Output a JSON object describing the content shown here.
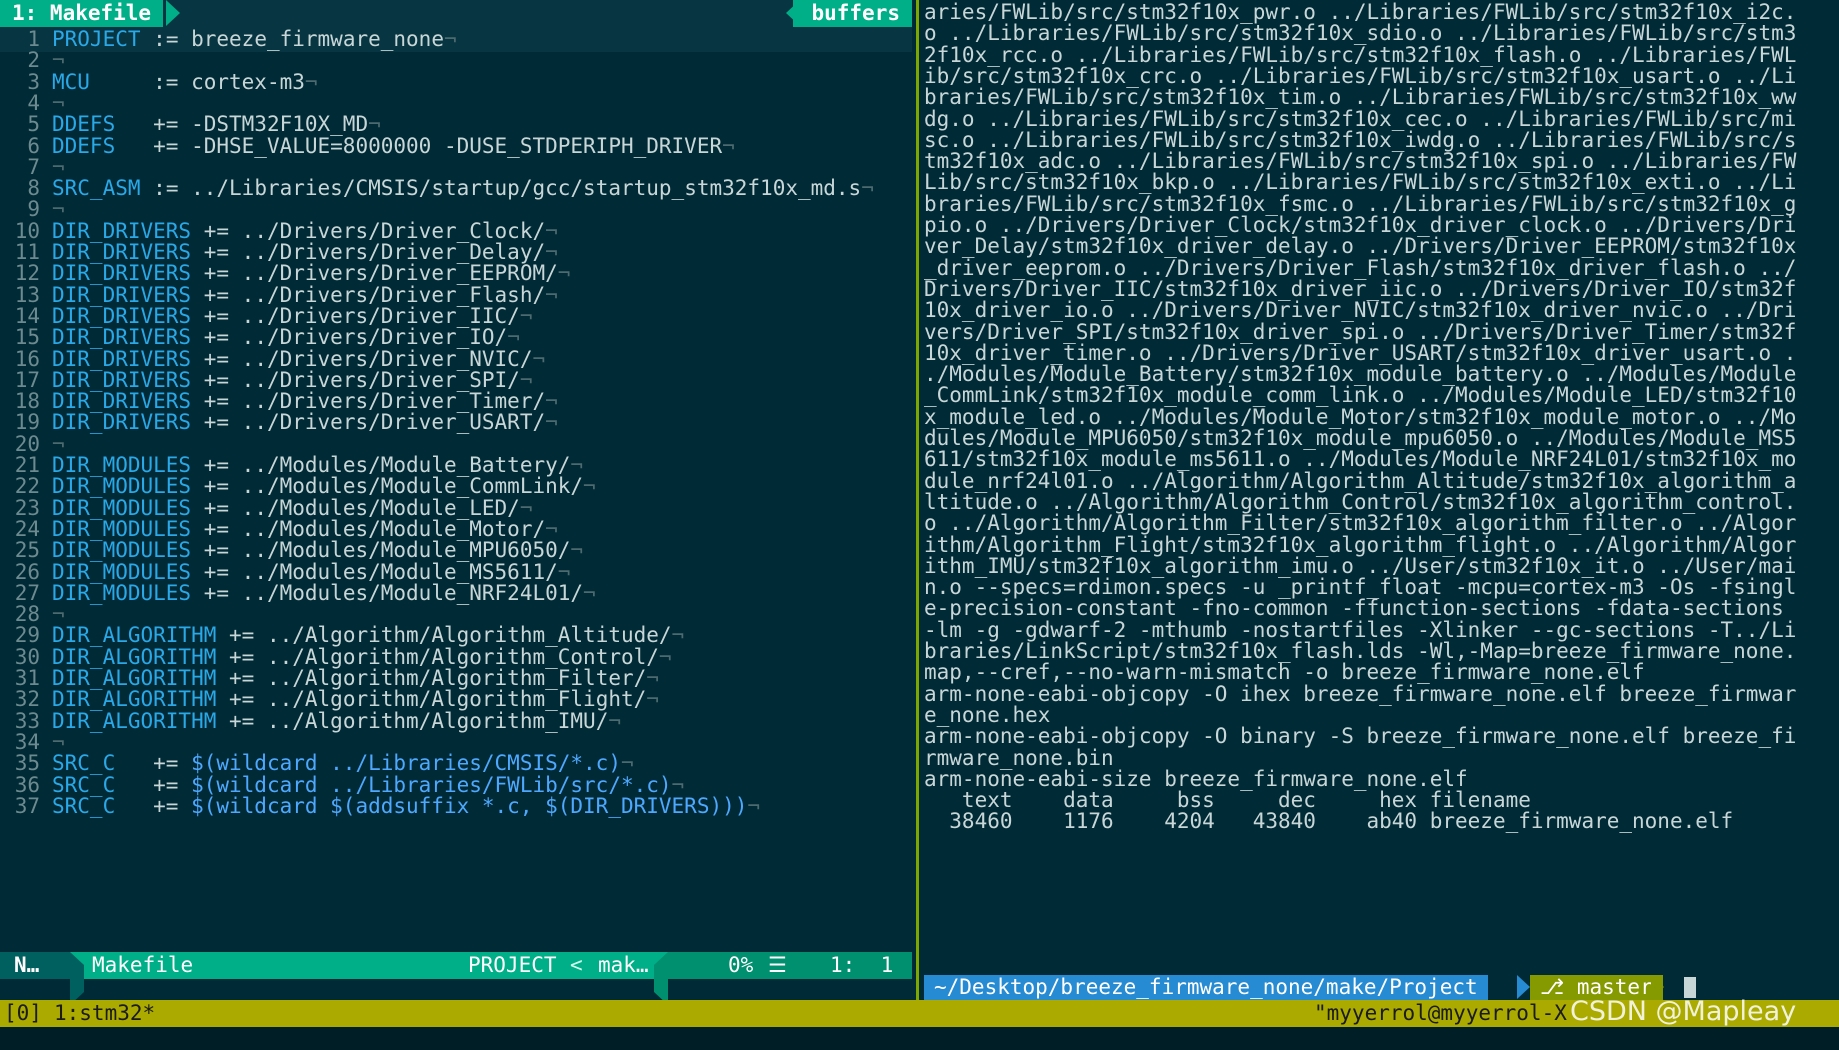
{
  "vim": {
    "tab_active": "1: Makefile",
    "tab_buffers": "buffers",
    "lines": [
      {
        "n": "1",
        "kw": "PROJECT",
        "pad": " ",
        "op": ":= ",
        "rest": "breeze_firmware_none"
      },
      {
        "n": "2",
        "kw": "",
        "pad": "",
        "op": "",
        "rest": ""
      },
      {
        "n": "3",
        "kw": "MCU",
        "pad": "     ",
        "op": ":= ",
        "rest": "cortex-m3"
      },
      {
        "n": "4",
        "kw": "",
        "pad": "",
        "op": "",
        "rest": ""
      },
      {
        "n": "5",
        "kw": "DDEFS",
        "pad": "   ",
        "op": "+= ",
        "rest": "-DSTM32F10X_MD"
      },
      {
        "n": "6",
        "kw": "DDEFS",
        "pad": "   ",
        "op": "+= ",
        "rest": "-DHSE_VALUE=8000000 -DUSE_STDPERIPH_DRIVER"
      },
      {
        "n": "7",
        "kw": "",
        "pad": "",
        "op": "",
        "rest": ""
      },
      {
        "n": "8",
        "kw": "SRC_ASM",
        "pad": " ",
        "op": ":= ",
        "rest": "../Libraries/CMSIS/startup/gcc/startup_stm32f10x_md.s"
      },
      {
        "n": "9",
        "kw": "",
        "pad": "",
        "op": "",
        "rest": ""
      },
      {
        "n": "10",
        "kw": "DIR_DRIVERS",
        "pad": " ",
        "op": "+= ",
        "rest": "../Drivers/Driver_Clock/"
      },
      {
        "n": "11",
        "kw": "DIR_DRIVERS",
        "pad": " ",
        "op": "+= ",
        "rest": "../Drivers/Driver_Delay/"
      },
      {
        "n": "12",
        "kw": "DIR_DRIVERS",
        "pad": " ",
        "op": "+= ",
        "rest": "../Drivers/Driver_EEPROM/"
      },
      {
        "n": "13",
        "kw": "DIR_DRIVERS",
        "pad": " ",
        "op": "+= ",
        "rest": "../Drivers/Driver_Flash/"
      },
      {
        "n": "14",
        "kw": "DIR_DRIVERS",
        "pad": " ",
        "op": "+= ",
        "rest": "../Drivers/Driver_IIC/"
      },
      {
        "n": "15",
        "kw": "DIR_DRIVERS",
        "pad": " ",
        "op": "+= ",
        "rest": "../Drivers/Driver_IO/"
      },
      {
        "n": "16",
        "kw": "DIR_DRIVERS",
        "pad": " ",
        "op": "+= ",
        "rest": "../Drivers/Driver_NVIC/"
      },
      {
        "n": "17",
        "kw": "DIR_DRIVERS",
        "pad": " ",
        "op": "+= ",
        "rest": "../Drivers/Driver_SPI/"
      },
      {
        "n": "18",
        "kw": "DIR_DRIVERS",
        "pad": " ",
        "op": "+= ",
        "rest": "../Drivers/Driver_Timer/"
      },
      {
        "n": "19",
        "kw": "DIR_DRIVERS",
        "pad": " ",
        "op": "+= ",
        "rest": "../Drivers/Driver_USART/"
      },
      {
        "n": "20",
        "kw": "",
        "pad": "",
        "op": "",
        "rest": ""
      },
      {
        "n": "21",
        "kw": "DIR_MODULES",
        "pad": " ",
        "op": "+= ",
        "rest": "../Modules/Module_Battery/"
      },
      {
        "n": "22",
        "kw": "DIR_MODULES",
        "pad": " ",
        "op": "+= ",
        "rest": "../Modules/Module_CommLink/"
      },
      {
        "n": "23",
        "kw": "DIR_MODULES",
        "pad": " ",
        "op": "+= ",
        "rest": "../Modules/Module_LED/"
      },
      {
        "n": "24",
        "kw": "DIR_MODULES",
        "pad": " ",
        "op": "+= ",
        "rest": "../Modules/Module_Motor/"
      },
      {
        "n": "25",
        "kw": "DIR_MODULES",
        "pad": " ",
        "op": "+= ",
        "rest": "../Modules/Module_MPU6050/"
      },
      {
        "n": "26",
        "kw": "DIR_MODULES",
        "pad": " ",
        "op": "+= ",
        "rest": "../Modules/Module_MS5611/"
      },
      {
        "n": "27",
        "kw": "DIR_MODULES",
        "pad": " ",
        "op": "+= ",
        "rest": "../Modules/Module_NRF24L01/"
      },
      {
        "n": "28",
        "kw": "",
        "pad": "",
        "op": "",
        "rest": ""
      },
      {
        "n": "29",
        "kw": "DIR_ALGORITHM",
        "pad": " ",
        "op": "+= ",
        "rest": "../Algorithm/Algorithm_Altitude/"
      },
      {
        "n": "30",
        "kw": "DIR_ALGORITHM",
        "pad": " ",
        "op": "+= ",
        "rest": "../Algorithm/Algorithm_Control/"
      },
      {
        "n": "31",
        "kw": "DIR_ALGORITHM",
        "pad": " ",
        "op": "+= ",
        "rest": "../Algorithm/Algorithm_Filter/"
      },
      {
        "n": "32",
        "kw": "DIR_ALGORITHM",
        "pad": " ",
        "op": "+= ",
        "rest": "../Algorithm/Algorithm_Flight/"
      },
      {
        "n": "33",
        "kw": "DIR_ALGORITHM",
        "pad": " ",
        "op": "+= ",
        "rest": "../Algorithm/Algorithm_IMU/"
      },
      {
        "n": "34",
        "kw": "",
        "pad": "",
        "op": "",
        "rest": ""
      },
      {
        "n": "35",
        "kw": "SRC_C",
        "pad": "   ",
        "op": "+= ",
        "rest": "$(wildcard ../Libraries/CMSIS/*.c)"
      },
      {
        "n": "36",
        "kw": "SRC_C",
        "pad": "   ",
        "op": "+= ",
        "rest": "$(wildcard ../Libraries/FWLib/src/*.c)"
      },
      {
        "n": "37",
        "kw": "SRC_C",
        "pad": "   ",
        "op": "+= ",
        "rest": "$(wildcard $(addsuffix *.c, $(DIR_DRIVERS)))"
      }
    ],
    "eol_marker": "¬",
    "status": {
      "mode": "N…",
      "file": "Makefile",
      "tag": "PROJECT",
      "sep": "<",
      "mak": "mak…",
      "percent": "0%",
      "lines_icon": "☰",
      "position": "1:  1"
    }
  },
  "shell": {
    "output": [
      "aries/FWLib/src/stm32f10x_pwr.o ../Libraries/FWLib/src/stm32f10x_i2c.",
      "o ../Libraries/FWLib/src/stm32f10x_sdio.o ../Libraries/FWLib/src/stm3",
      "2f10x_rcc.o ../Libraries/FWLib/src/stm32f10x_flash.o ../Libraries/FWL",
      "ib/src/stm32f10x_crc.o ../Libraries/FWLib/src/stm32f10x_usart.o ../Li",
      "braries/FWLib/src/stm32f10x_tim.o ../Libraries/FWLib/src/stm32f10x_ww",
      "dg.o ../Libraries/FWLib/src/stm32f10x_cec.o ../Libraries/FWLib/src/mi",
      "sc.o ../Libraries/FWLib/src/stm32f10x_iwdg.o ../Libraries/FWLib/src/s",
      "tm32f10x_adc.o ../Libraries/FWLib/src/stm32f10x_spi.o ../Libraries/FW",
      "Lib/src/stm32f10x_bkp.o ../Libraries/FWLib/src/stm32f10x_exti.o ../Li",
      "braries/FWLib/src/stm32f10x_fsmc.o ../Libraries/FWLib/src/stm32f10x_g",
      "pio.o ../Drivers/Driver_Clock/stm32f10x_driver_clock.o ../Drivers/Dri",
      "ver_Delay/stm32f10x_driver_delay.o ../Drivers/Driver_EEPROM/stm32f10x",
      "_driver_eeprom.o ../Drivers/Driver_Flash/stm32f10x_driver_flash.o ../",
      "Drivers/Driver_IIC/stm32f10x_driver_iic.o ../Drivers/Driver_IO/stm32f",
      "10x_driver_io.o ../Drivers/Driver_NVIC/stm32f10x_driver_nvic.o ../Dri",
      "vers/Driver_SPI/stm32f10x_driver_spi.o ../Drivers/Driver_Timer/stm32f",
      "10x_driver_timer.o ../Drivers/Driver_USART/stm32f10x_driver_usart.o .",
      "./Modules/Module_Battery/stm32f10x_module_battery.o ../Modules/Module",
      "_CommLink/stm32f10x_module_comm_link.o ../Modules/Module_LED/stm32f10",
      "x_module_led.o ../Modules/Module_Motor/stm32f10x_module_motor.o ../Mo",
      "dules/Module_MPU6050/stm32f10x_module_mpu6050.o ../Modules/Module_MS5",
      "611/stm32f10x_module_ms5611.o ../Modules/Module_NRF24L01/stm32f10x_mo",
      "dule_nrf24l01.o ../Algorithm/Algorithm_Altitude/stm32f10x_algorithm_a",
      "ltitude.o ../Algorithm/Algorithm_Control/stm32f10x_algorithm_control.",
      "o ../Algorithm/Algorithm_Filter/stm32f10x_algorithm_filter.o ../Algor",
      "ithm/Algorithm_Flight/stm32f10x_algorithm_flight.o ../Algorithm/Algor",
      "ithm_IMU/stm32f10x_algorithm_imu.o ../User/stm32f10x_it.o ../User/mai",
      "n.o --specs=rdimon.specs -u _printf_float -mcpu=cortex-m3 -Os -fsingl",
      "e-precision-constant -fno-common -ffunction-sections -fdata-sections",
      "-lm -g -gdwarf-2 -mthumb -nostartfiles -Xlinker --gc-sections -T../Li",
      "braries/LinkScript/stm32f10x_flash.lds -Wl,-Map=breeze_firmware_none.",
      "map,--cref,--no-warn-mismatch -o breeze_firmware_none.elf",
      "arm-none-eabi-objcopy -O ihex breeze_firmware_none.elf breeze_firmwar",
      "e_none.hex",
      "arm-none-eabi-objcopy -O binary -S breeze_firmware_none.elf breeze_fi",
      "rmware_none.bin",
      "arm-none-eabi-size breeze_firmware_none.elf",
      "   text    data     bss     dec     hex filename",
      "  38460    1176    4204   43840    ab40 breeze_firmware_none.elf"
    ],
    "prompt": {
      "path": "~/Desktop/breeze_firmware_none/make/Project",
      "branch_icon": "⎇",
      "branch": "master"
    }
  },
  "tmux": {
    "session": "[0]",
    "window": "1:stm32*",
    "right": "\"myyerrol@myyerrol-X"
  },
  "watermark": "CSDN @Mapleay"
}
